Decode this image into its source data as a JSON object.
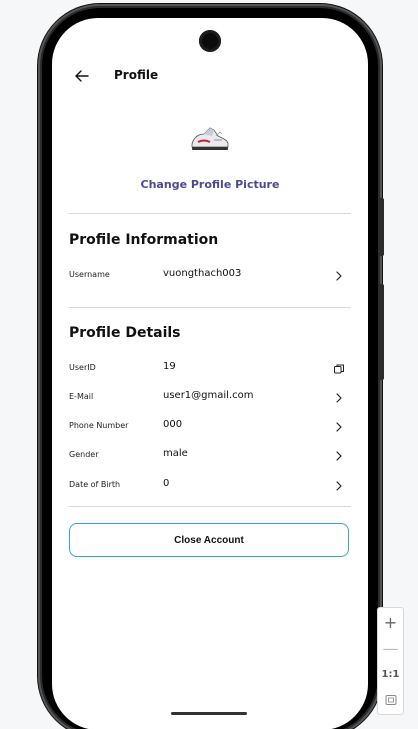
{
  "header": {
    "back_icon": "arrow-left-icon",
    "title": "Profile"
  },
  "avatar": {
    "icon": "sneaker-image",
    "change_label": "Change Profile Picture"
  },
  "profile_information": {
    "title": "Profile Information",
    "rows": [
      {
        "label": "Username",
        "value": "vuongthach003",
        "action_icon": "chevron-right-icon"
      }
    ]
  },
  "profile_details": {
    "title": "Profile Details",
    "rows": [
      {
        "label": "UserID",
        "value": "19",
        "action_icon": "copy-icon"
      },
      {
        "label": "E-Mail",
        "value": "user1@gmail.com",
        "action_icon": "chevron-right-icon"
      },
      {
        "label": "Phone Number",
        "value": "000",
        "action_icon": "chevron-right-icon"
      },
      {
        "label": "Gender",
        "value": "male",
        "action_icon": "chevron-right-icon"
      },
      {
        "label": "Date of Birth",
        "value": "0",
        "action_icon": "chevron-right-icon"
      }
    ]
  },
  "close_account": {
    "label": "Close Account",
    "border_color": "#3aa7c9"
  },
  "zoom_controls": {
    "zoom_in": "+",
    "zoom_out": "—",
    "reset": "1:1",
    "fit_icon": "fit-screen-icon"
  },
  "colors": {
    "accent": "#4d4a8f"
  }
}
